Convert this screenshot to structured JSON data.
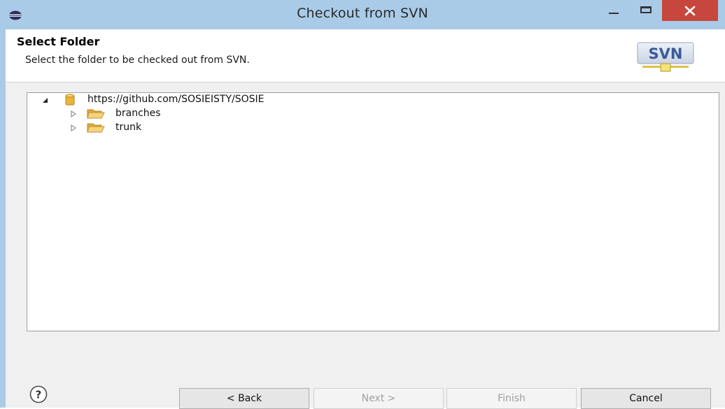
{
  "window": {
    "title": "Checkout from SVN"
  },
  "header": {
    "title": "Select Folder",
    "description": "Select the folder to be checked out from SVN.",
    "logo_text": "SVN"
  },
  "tree": {
    "root": {
      "label": "https://github.com/SOSIEISTY/SOSIE",
      "expanded": true,
      "icon": "repository-icon"
    },
    "children": [
      {
        "label": "branches",
        "expanded": false,
        "icon": "folder-icon"
      },
      {
        "label": "trunk",
        "expanded": false,
        "icon": "folder-icon"
      }
    ]
  },
  "buttons": {
    "back": "< Back",
    "next": "Next >",
    "finish": "Finish",
    "cancel": "Cancel"
  },
  "colors": {
    "titlebar": "#a9cbe8",
    "close": "#c7463d",
    "folder": "#f2c566",
    "repository": "#e8b43a"
  }
}
